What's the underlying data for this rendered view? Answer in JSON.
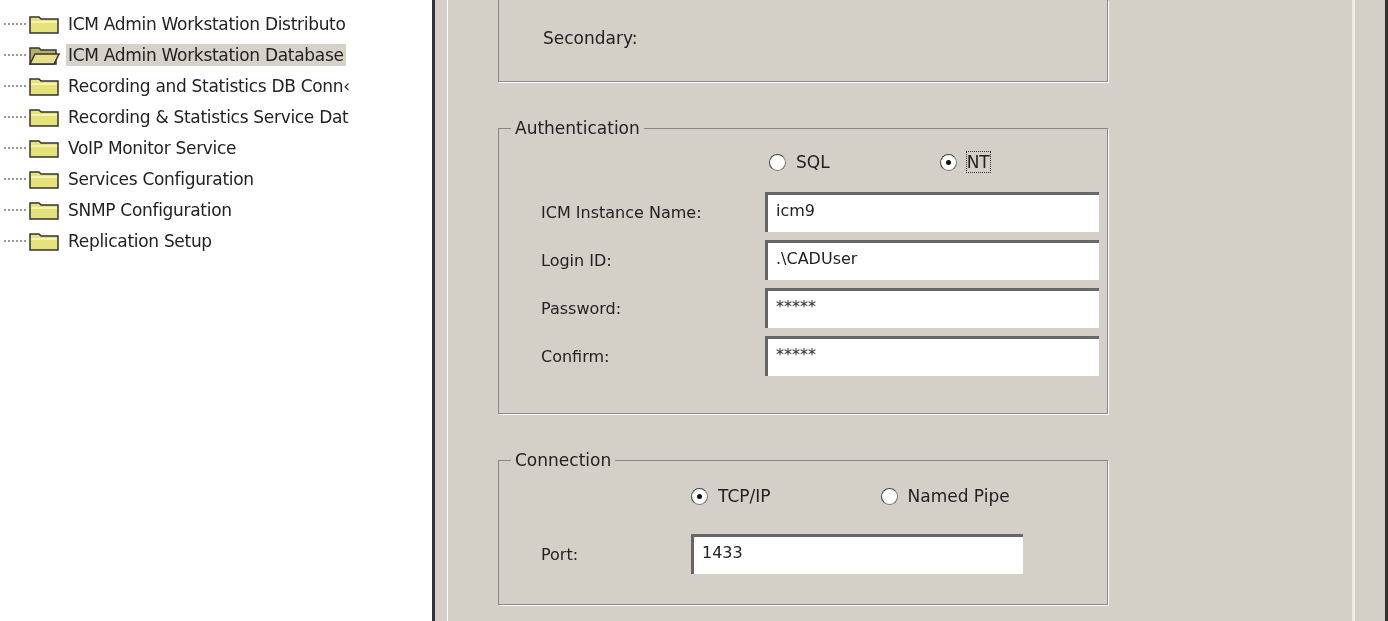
{
  "tree": {
    "items": [
      {
        "label": "ICM Admin Workstation Distributo",
        "selected": false
      },
      {
        "label": "ICM Admin Workstation Database",
        "selected": true
      },
      {
        "label": "Recording and Statistics DB Conn‹",
        "selected": false
      },
      {
        "label": "Recording & Statistics Service Dat",
        "selected": false
      },
      {
        "label": "VoIP Monitor Service",
        "selected": false
      },
      {
        "label": "Services Configuration",
        "selected": false
      },
      {
        "label": "SNMP Configuration",
        "selected": false
      },
      {
        "label": "Replication Setup",
        "selected": false
      }
    ]
  },
  "secondary_group": {
    "label": "Secondary:"
  },
  "authentication": {
    "title": "Authentication",
    "options": [
      {
        "label": "SQL",
        "selected": false
      },
      {
        "label": "NT",
        "selected": true
      }
    ],
    "fields": [
      {
        "label": "ICM Instance Name:",
        "value": "icm9"
      },
      {
        "label": "Login ID:",
        "value": ".\\CADUser"
      },
      {
        "label": "Password:",
        "value": "*****"
      },
      {
        "label": "Confirm:",
        "value": "*****"
      }
    ]
  },
  "connection": {
    "title": "Connection",
    "options": [
      {
        "label": "TCP/IP",
        "selected": true
      },
      {
        "label": "Named Pipe",
        "selected": false
      }
    ],
    "fields": [
      {
        "label": "Port:",
        "value": "1433"
      }
    ]
  }
}
